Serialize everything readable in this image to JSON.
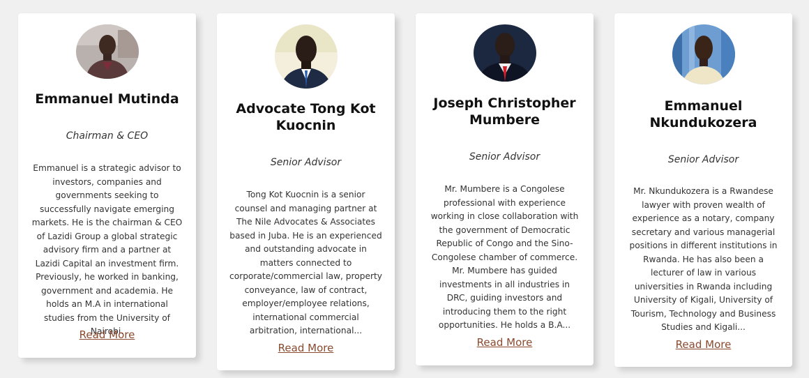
{
  "read_more_label": "Read More",
  "link_color": "#8a4a2e",
  "team": [
    {
      "name": "Emmanuel Mutinda",
      "role": "Chairman & CEO",
      "bio": "Emmanuel is a strategic advisor to investors, companies and governments seeking to successfully navigate emerging markets. He is the chairman & CEO of Lazidi Group a global strategic advisory firm and a partner at Lazidi Capital an investment firm. Previously, he worked in banking, government and academia. He holds an M.A in international studies from the University of Nairobi."
    },
    {
      "name": "Advocate Tong Kot Kuocnin",
      "role": "Senior Advisor",
      "bio": "Tong Kot Kuocnin is a senior counsel and managing partner at The Nile Advocates & Associates based in Juba. He is an experienced and outstanding advocate in matters connected to corporate/commercial law, property conveyance, law of contract, employer/employee relations, international commercial arbitration, international..."
    },
    {
      "name": "Joseph Christopher Mumbere",
      "role": "Senior Advisor",
      "bio": "Mr. Mumbere is a Congolese professional with experience working in close collaboration with the government of Democratic Republic of Congo and the Sino-Congolese chamber of commerce. Mr. Mumbere has guided investments in all industries in DRC, guiding investors and introducing them to the right opportunities. He holds a B.A..."
    },
    {
      "name": "Emmanuel Nkundukozera",
      "role": "Senior Advisor",
      "bio": "Mr. Nkundukozera is a Rwandese lawyer with proven wealth of experience as a notary, company secretary and various managerial positions in different institutions in Rwanda. He has also been a lecturer of law in various universities in Rwanda including University of Kigali, University of Tourism, Technology and Business Studies and Kigali..."
    }
  ]
}
